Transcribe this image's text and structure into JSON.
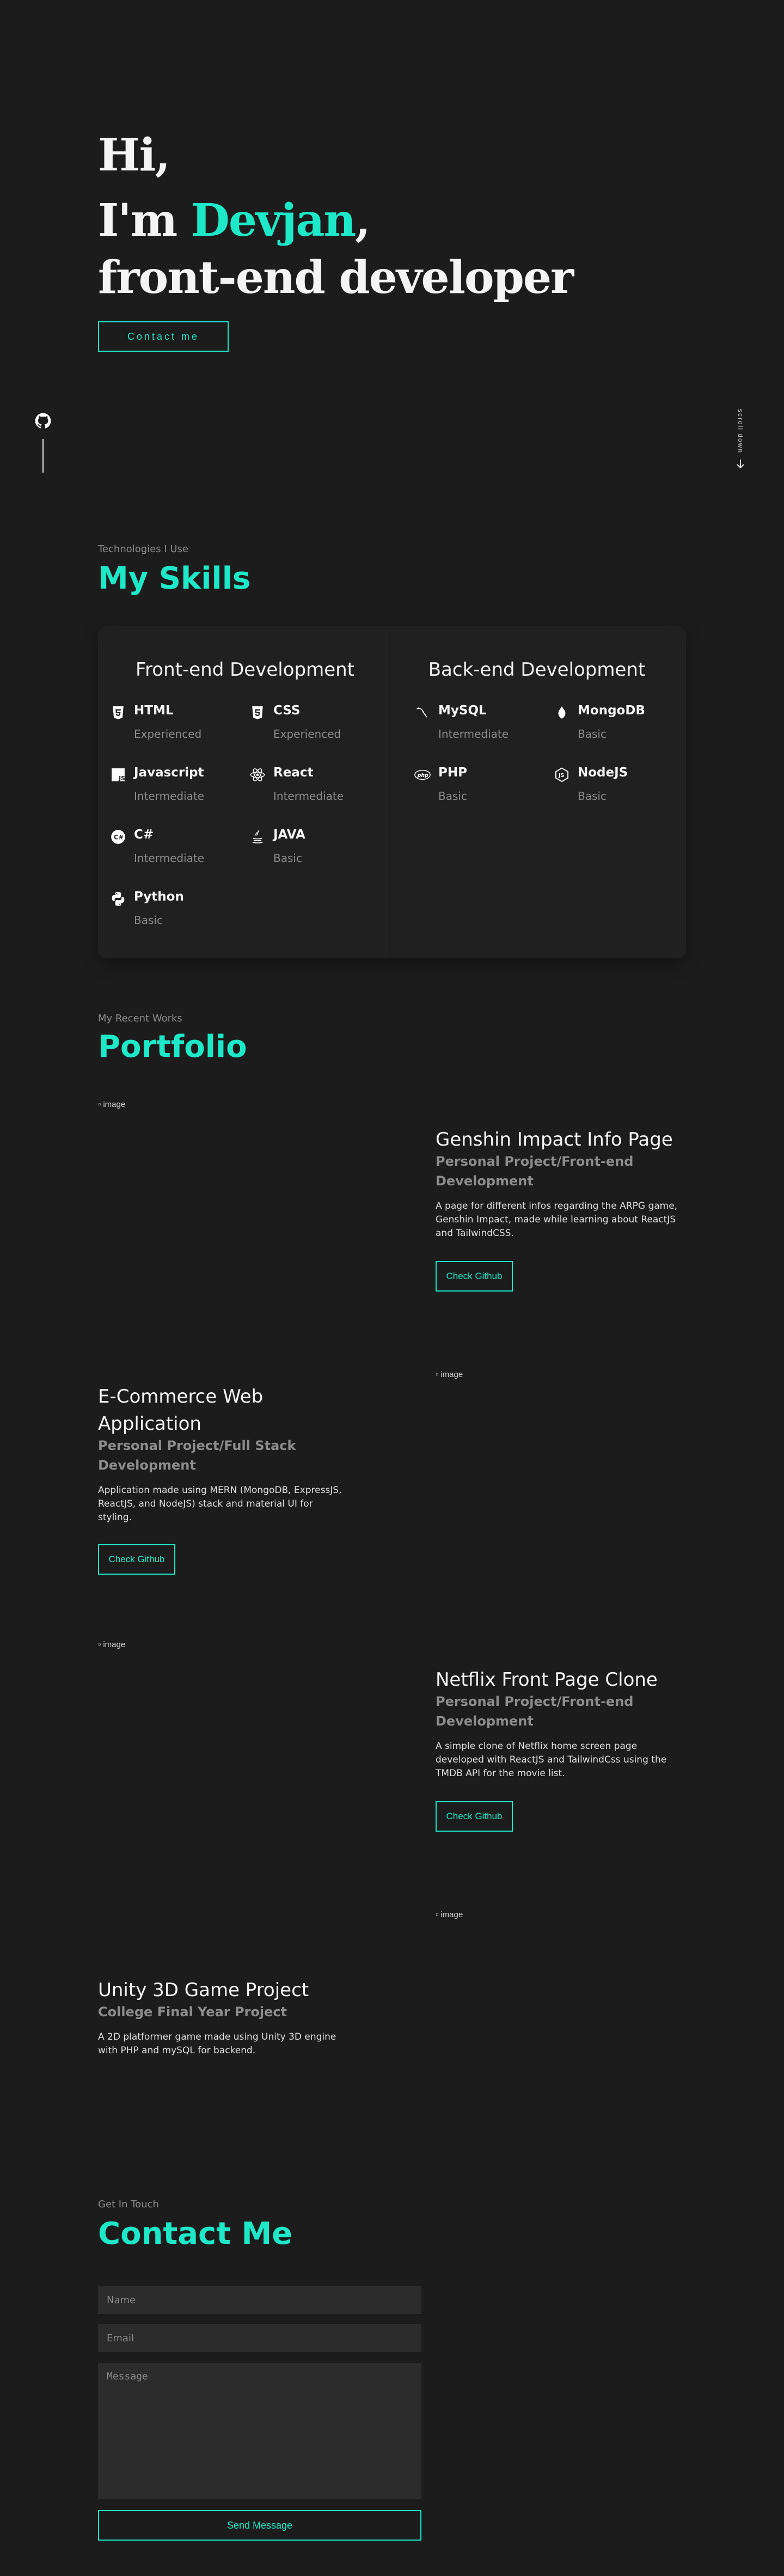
{
  "hero": {
    "greeting": "Hi,",
    "im": "I'm ",
    "name": "Devjan",
    "comma": ",",
    "role": "front-end developer",
    "contact_button": "Contact me",
    "scroll_label": "scroll down"
  },
  "skills": {
    "subtitle": "Technologies I Use",
    "title": "My Skills",
    "frontend": {
      "title": "Front-end Development",
      "items": [
        {
          "name": "HTML",
          "level": "Experienced",
          "icon": "html5-icon"
        },
        {
          "name": "CSS",
          "level": "Experienced",
          "icon": "css3-icon"
        },
        {
          "name": "Javascript",
          "level": "Intermediate",
          "icon": "javascript-icon"
        },
        {
          "name": "React",
          "level": "Intermediate",
          "icon": "react-icon"
        },
        {
          "name": "C#",
          "level": "Intermediate",
          "icon": "csharp-icon"
        },
        {
          "name": "JAVA",
          "level": "Basic",
          "icon": "java-icon"
        },
        {
          "name": "Python",
          "level": "Basic",
          "icon": "python-icon"
        }
      ]
    },
    "backend": {
      "title": "Back-end Development",
      "items": [
        {
          "name": "MySQL",
          "level": "Intermediate",
          "icon": "mysql-icon"
        },
        {
          "name": "MongoDB",
          "level": "Basic",
          "icon": "mongodb-icon"
        },
        {
          "name": "PHP",
          "level": "Basic",
          "icon": "php-icon"
        },
        {
          "name": "NodeJS",
          "level": "Basic",
          "icon": "nodejs-icon"
        }
      ]
    }
  },
  "portfolio": {
    "subtitle": "My Recent Works",
    "title": "Portfolio",
    "image_alt": "image",
    "projects": [
      {
        "title": "Genshin Impact Info Page",
        "type_line1": "Personal Project/Front-end",
        "type_line2": "Development",
        "desc_line1": "A page for different infos regarding the ARPG game,",
        "desc_line2": "Genshin Impact, made while learning about ReactJS",
        "desc_line3": "and TailwindCSS.",
        "button": "Check Github"
      },
      {
        "title_line1": "E-Commerce Web",
        "title_line2": "Application",
        "type_line1": "Personal Project/Full Stack",
        "type_line2": "Development",
        "desc_line1": "Application made using MERN (MongoDB, ExpressJS,",
        "desc_line2": "ReactJS, and NodeJS) stack and material UI for",
        "desc_line3": "styling.",
        "button": "Check Github"
      },
      {
        "title": "Netflix Front Page Clone",
        "type_line1": "Personal Project/Front-end",
        "type_line2": "Development",
        "desc_line1": "A simple clone of Netflix home screen page",
        "desc_line2": "developed with ReactJS and TailwindCss using the",
        "desc_line3": "TMDB API for the movie list.",
        "button": "Check Github"
      },
      {
        "title": "Unity 3D Game Project",
        "type_line1": "College Final Year Project",
        "desc_line1": "A 2D platformer game made using Unity 3D engine",
        "desc_line2": "with PHP and mySQL for backend."
      }
    ]
  },
  "contact": {
    "subtitle": "Get In Touch",
    "title": "Contact Me",
    "name_placeholder": "Name",
    "email_placeholder": "Email",
    "message_placeholder": "Message",
    "send_button": "Send Message"
  },
  "colors": {
    "background": "#1c1c1c",
    "accent": "#1de9c8",
    "muted": "#8d8d8d",
    "card": "#202020",
    "field": "#2c2c2c"
  }
}
